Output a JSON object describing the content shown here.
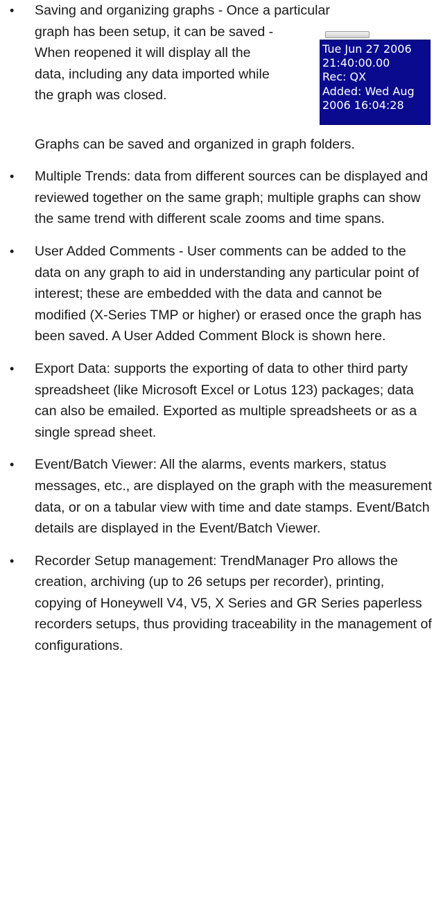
{
  "bullet_symbol": "•",
  "items": [
    {
      "first_line": "Saving and organizing graphs - Once a particular",
      "wrap_text": "graph has been setup, it can be saved - When reopened it will display all the data, including any data imported while the graph was closed.",
      "after_text": "Graphs can be saved and organized in graph folders.",
      "comment_block": {
        "lines": [
          "Tue Jun 27 2006",
          "21:40:00.00",
          "Rec: QX",
          "Added: Wed Aug",
          "2006 16:04:28"
        ]
      }
    },
    {
      "text": "Multiple Trends: data from different sources can be displayed and reviewed together on the same graph; multiple graphs can show the same trend with different scale zooms and time spans."
    },
    {
      "text": "User Added Comments - User comments can be added to the data on any graph to aid in understanding any particular point of interest; these are embedded with the data and cannot be modified (X-Series TMP or higher) or erased once the graph has been saved. A User Added Comment Block is shown here."
    },
    {
      "text": "Export Data: supports the exporting of data to other third party spreadsheet (like Microsoft Excel or Lotus 123) packages; data can also be emailed. Exported as multiple spreadsheets or as a single spread sheet."
    },
    {
      "text": "Event/Batch Viewer: All the alarms, events markers, status messages, etc., are displayed on the graph with the measurement data, or on a tabular view with time and date stamps. Event/Batch details are displayed in the Event/Batch Viewer."
    },
    {
      "text": "Recorder Setup management: TrendManager Pro allows the creation, archiving (up to 26 setups per recorder), printing, copying of Honeywell V4, V5, X Series and GR Series paperless recorders setups, thus providing traceability in the management of configurations."
    }
  ]
}
